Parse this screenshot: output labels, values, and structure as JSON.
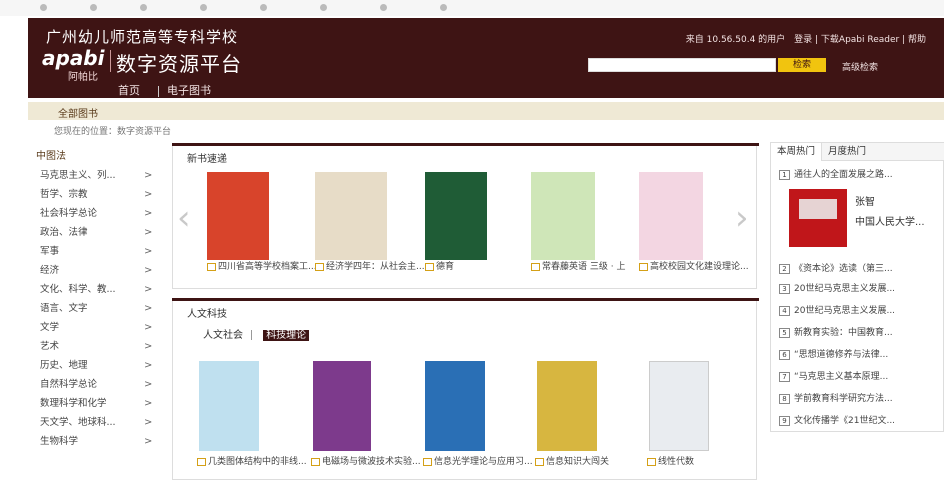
{
  "header": {
    "school": "广州幼儿师范高等专科学校",
    "logo_text": "apabi",
    "logo_sub": "阿帕比",
    "platform": "数字资源平台",
    "nav": [
      "首页",
      "电子图书"
    ],
    "toplinks": "来自 10.56.50.4 的用户　登录 | 下载Apabi Reader | 帮助",
    "search_button": "检索",
    "advanced": "高级检索"
  },
  "band": {
    "label": "全部图书"
  },
  "breadcrumb": "您现在的位置：数字资源平台",
  "sidebar": {
    "head": "中图法",
    "items": [
      "马克思主义、列...",
      "哲学、宗教",
      "社会科学总论",
      "政治、法律",
      "军事",
      "经济",
      "文化、科学、教...",
      "语言、文字",
      "文学",
      "艺术",
      "历史、地理",
      "自然科学总论",
      "数理科学和化学",
      "天文学、地球科...",
      "生物科学"
    ]
  },
  "new_books": {
    "title": "新书速递",
    "books": [
      {
        "title": "四川省高等学校档案工...",
        "color": "#d8442b"
      },
      {
        "title": "经济学四年：从社会主...",
        "color": "#e7dcc7"
      },
      {
        "title": "德育",
        "color": "#1f5c36"
      },
      {
        "title": "常春藤英语 三级 · 上",
        "color": "#cfe6b8"
      },
      {
        "title": "高校校园文化建设理论...",
        "color": "#f3d6e2"
      }
    ]
  },
  "humanities": {
    "title": "人文科技",
    "tabs": [
      "人文社会",
      "科技理论"
    ],
    "books": [
      {
        "title": "几类图体结构中的非线...",
        "color": "#bfe0ef"
      },
      {
        "title": "电磁场与微波技术实验...",
        "color": "#7d3a8c"
      },
      {
        "title": "信息光学理论与应用习...",
        "color": "#2a6fb5"
      },
      {
        "title": "信息知识大闯关",
        "color": "#d7b640"
      },
      {
        "title": "线性代数",
        "color": "#e9ecf0"
      }
    ]
  },
  "hot": {
    "tabs": [
      "本周热门",
      "月度热门"
    ],
    "top_item": "通往人的全面发展之路...",
    "feature_author": "张智",
    "feature_publisher": "中国人民大学...",
    "items": [
      "《资本论》选读（第三...",
      "20世纪马克思主义发展...",
      "20世纪马克思主义发展...",
      "新教育实验：中国教育...",
      "“思想道德修养与法律...",
      "“马克思主义基本原理...",
      "学前教育科学研究方法...",
      "文化传播学《21世纪文..."
    ],
    "numbers": [
      "1",
      "2",
      "3",
      "4",
      "5",
      "6",
      "7",
      "8",
      "9"
    ]
  },
  "colors": {
    "header_bg": "#3e1414",
    "accent": "#f1c40f",
    "band_bg": "#efe9d5"
  }
}
